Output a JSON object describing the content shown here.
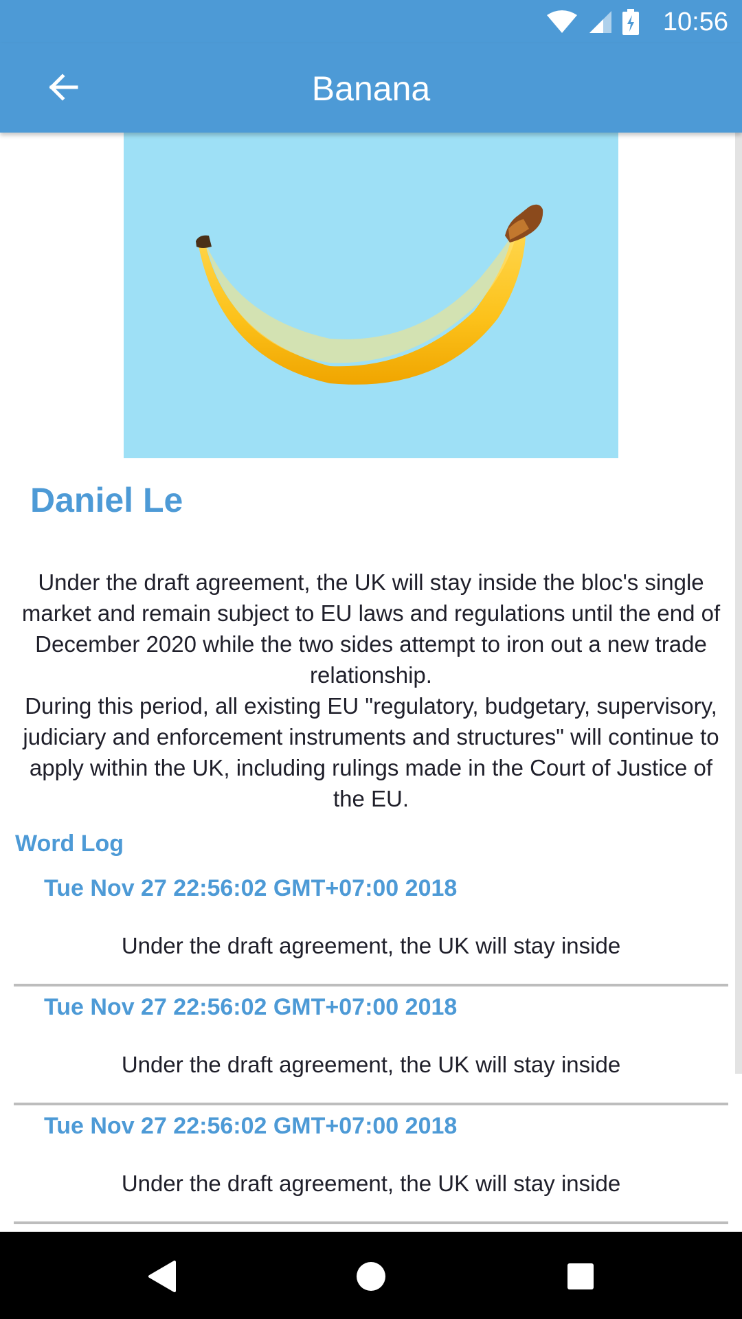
{
  "status_bar": {
    "time": "10:56",
    "icons": [
      "wifi-icon",
      "cell-signal-icon",
      "battery-charging-icon"
    ]
  },
  "app_bar": {
    "title": "Banana",
    "back_icon": "arrow-back-icon"
  },
  "hero": {
    "background": "#9ee0f6",
    "subject": "banana"
  },
  "author": "Daniel Le",
  "body": [
    "Under the draft agreement, the UK will stay inside the bloc's single market and remain subject to EU laws and regulations until the end of December 2020 while the two sides attempt to iron out a new trade relationship.",
    "During this period, all existing EU \"regulatory, budgetary, supervisory, judiciary and enforcement instruments and structures\" will continue to apply within the UK, including rulings made in the Court of Justice of the EU."
  ],
  "word_log": {
    "heading": "Word Log",
    "entries": [
      {
        "date": "Tue Nov 27 22:56:02 GMT+07:00 2018",
        "text": "Under the draft agreement, the UK will stay inside"
      },
      {
        "date": "Tue Nov 27 22:56:02 GMT+07:00 2018",
        "text": "Under the draft agreement, the UK will stay inside"
      },
      {
        "date": "Tue Nov 27 22:56:02 GMT+07:00 2018",
        "text": "Under the draft agreement, the UK will stay inside"
      }
    ]
  },
  "nav_bar": {
    "icons": [
      "nav-back-icon",
      "nav-home-icon",
      "nav-recents-icon"
    ]
  },
  "colors": {
    "primary": "#4d9ad6",
    "hero_bg": "#9ee0f6",
    "text": "#1f1f2a",
    "divider": "#bdbdbd"
  }
}
